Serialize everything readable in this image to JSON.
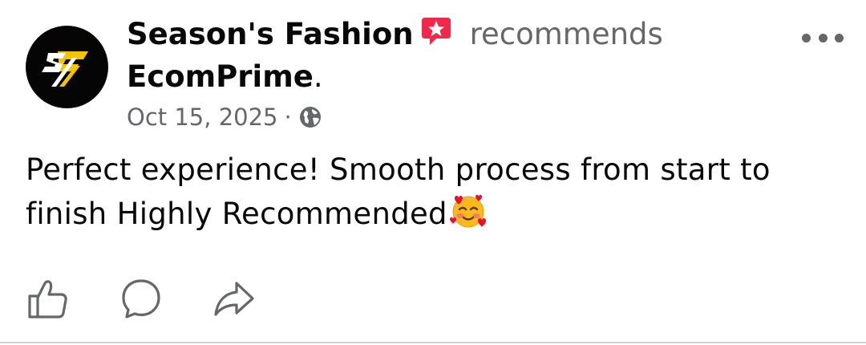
{
  "post": {
    "author": "Season's Fashion",
    "action_verb": "recommends",
    "page": "EcomPrime",
    "page_suffix": ".",
    "date": "Oct 15, 2025",
    "separator": "·",
    "privacy_icon": "globe-icon",
    "text": "Perfect experience! Smooth process from start to finish Highly Recommended",
    "emoji": "smiling-face-with-hearts"
  },
  "avatar": {
    "logo_icon": "sf-logo",
    "background": "#050505",
    "accent": "#f5c400"
  },
  "icons": {
    "recommend_badge": "recommend-star-icon",
    "more": "more-options-icon",
    "like": "like-thumb-icon",
    "comment": "comment-bubble-icon",
    "share": "share-arrow-icon"
  },
  "colors": {
    "primary_text": "#080809",
    "secondary_text": "#65676b",
    "recommend_badge": "#f02849"
  }
}
